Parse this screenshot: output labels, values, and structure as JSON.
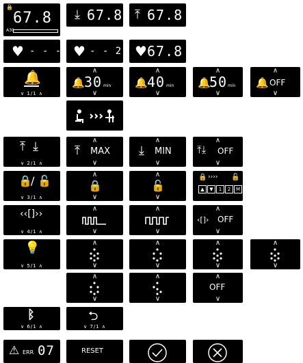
{
  "height": {
    "current": "67.8",
    "preset_low": "67.8",
    "preset_high": "67.8",
    "mini_label": "A30"
  },
  "heart": {
    "empty": "- - -",
    "partial": "- - 2",
    "value": "67.8"
  },
  "reminder": {
    "menu_index": "1/1",
    "options": [
      {
        "value": "30",
        "unit": "min"
      },
      {
        "value": "40",
        "unit": "min"
      },
      {
        "value": "50",
        "unit": "min"
      },
      {
        "value": "OFF",
        "unit": ""
      }
    ]
  },
  "limit": {
    "menu_index": "2/1",
    "max_label": "MAX",
    "min_label": "MIN",
    "off_label": "OFF"
  },
  "lock": {
    "menu_index": "3/1",
    "memory_keys": [
      "▲",
      "▼",
      "1",
      "2",
      "M"
    ]
  },
  "vibration": {
    "menu_index": "4/1",
    "off_label": "OFF"
  },
  "light": {
    "menu_index": "5/1",
    "off_label": "OFF"
  },
  "bluetooth": {
    "menu_index": "6/1"
  },
  "back": {
    "menu_index": "7/1"
  },
  "status": {
    "error_prefix": "ERR",
    "error_code": "07",
    "reset_label": "RESET"
  },
  "colors": {
    "tile_bg": "#000000",
    "tile_fg": "#ffffff",
    "page_bg": "#ffffff"
  }
}
